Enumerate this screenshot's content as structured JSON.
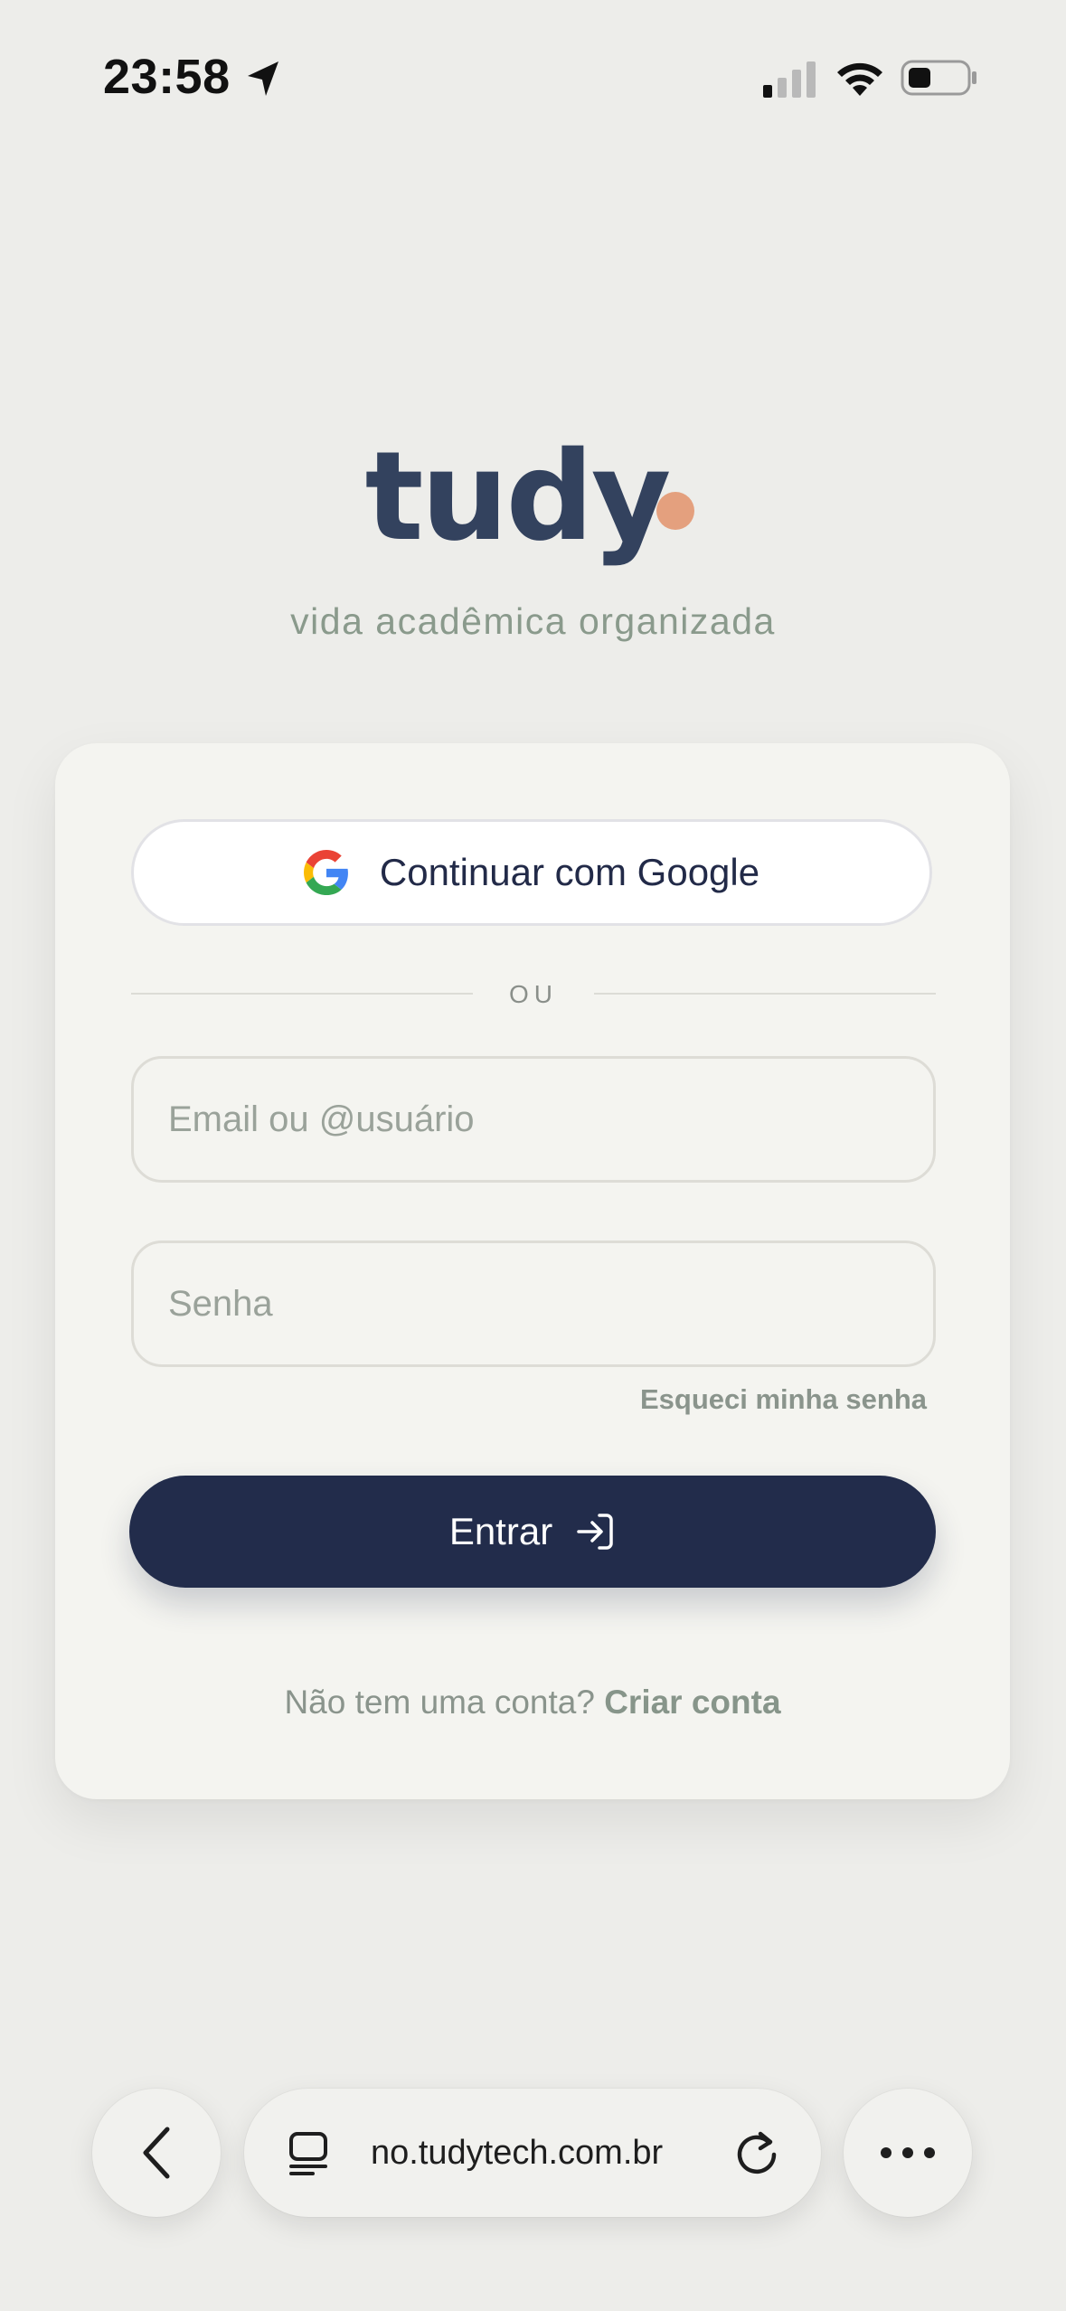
{
  "status_bar": {
    "time": "23:58",
    "icons": [
      "location-arrow-icon",
      "cellular-signal-icon",
      "wifi-icon",
      "battery-icon"
    ]
  },
  "brand": {
    "logo_text": "tudy",
    "tagline": "vida acadêmica organizada",
    "dot_color": "#e4a07e",
    "text_color": "#33425e"
  },
  "login_card": {
    "google_button_label": "Continuar com Google",
    "divider_text": "OU",
    "email_placeholder": "Email ou @usuário",
    "email_value": "",
    "password_placeholder": "Senha",
    "password_value": "",
    "forgot_password_label": "Esqueci minha senha",
    "submit_label": "Entrar",
    "submit_color": "#222c4b",
    "signup_prompt": "Não tem uma conta?",
    "signup_link_label": "Criar conta"
  },
  "browser_toolbar": {
    "url_display": "no.tudytech.com.br",
    "icons": [
      "back-chevron-icon",
      "tabs-icon",
      "reload-icon",
      "more-icon"
    ]
  }
}
